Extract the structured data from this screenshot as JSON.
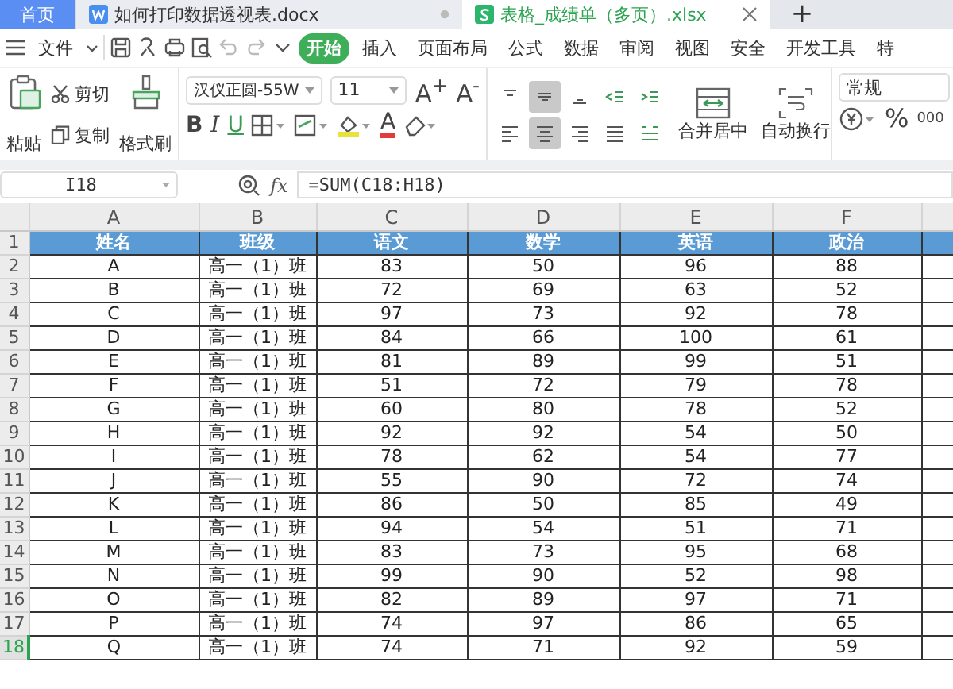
{
  "tabs": [
    {
      "label": "首页",
      "kind": "home",
      "selected": false
    },
    {
      "label": "如何打印数据透视表.docx",
      "kind": "doc",
      "selected": false
    },
    {
      "label": "表格_成绩单（多页）.xlsx",
      "kind": "sheet",
      "selected": true
    }
  ],
  "new_tab": "+",
  "menu": {
    "file": "文件",
    "items": [
      {
        "label": "开始",
        "selected": true
      },
      {
        "label": "插入",
        "selected": false
      },
      {
        "label": "页面布局",
        "selected": false
      },
      {
        "label": "公式",
        "selected": false
      },
      {
        "label": "数据",
        "selected": false
      },
      {
        "label": "审阅",
        "selected": false
      },
      {
        "label": "视图",
        "selected": false
      },
      {
        "label": "安全",
        "selected": false
      },
      {
        "label": "开发工具",
        "selected": false
      },
      {
        "label": "特",
        "selected": false
      }
    ]
  },
  "toolbar": {
    "paste": "粘贴",
    "cut": "剪切",
    "copy": "复制",
    "format_painter": "格式刷",
    "font": "汉仪正圆-55W",
    "size": "11",
    "grow": "A$^{+}$",
    "shrink": "A$^{-}$",
    "bold": "B",
    "italic": "I",
    "underline": "U",
    "font_color": "A",
    "merge": "合并居中",
    "wrap": "自动换行",
    "number_format": "常规",
    "percent": "%",
    "thousands": "000",
    "align": [
      {
        "kind": "top",
        "selected": false
      },
      {
        "kind": "middle",
        "selected": true
      },
      {
        "kind": "bottom",
        "selected": false
      },
      {
        "kind": "outdent",
        "selected": false
      },
      {
        "kind": "indent",
        "selected": false
      },
      {
        "kind": "left",
        "selected": false
      },
      {
        "kind": "center",
        "selected": true
      },
      {
        "kind": "right",
        "selected": false
      },
      {
        "kind": "justify",
        "selected": false
      },
      {
        "kind": "distributed",
        "selected": false
      }
    ]
  },
  "formula_bar": {
    "cell": "I18",
    "fx": "fx",
    "formula": "=SUM(C18:H18)"
  },
  "sheet": {
    "columns": [
      "A",
      "B",
      "C",
      "D",
      "E",
      "F"
    ],
    "rows": [
      {
        "number": "1",
        "selected": false,
        "header": true,
        "cells": [
          "姓名",
          "班级",
          "语文",
          "数学",
          "英语",
          "政治"
        ]
      },
      {
        "number": "2",
        "selected": false,
        "cells": [
          "A",
          "高一（1）班",
          "83",
          "50",
          "96",
          "88"
        ]
      },
      {
        "number": "3",
        "selected": false,
        "cells": [
          "B",
          "高一（1）班",
          "72",
          "69",
          "63",
          "52"
        ]
      },
      {
        "number": "4",
        "selected": false,
        "cells": [
          "C",
          "高一（1）班",
          "97",
          "73",
          "92",
          "78"
        ]
      },
      {
        "number": "5",
        "selected": false,
        "cells": [
          "D",
          "高一（1）班",
          "84",
          "66",
          "100",
          "61"
        ]
      },
      {
        "number": "6",
        "selected": false,
        "cells": [
          "E",
          "高一（1）班",
          "81",
          "89",
          "99",
          "51"
        ]
      },
      {
        "number": "7",
        "selected": false,
        "cells": [
          "F",
          "高一（1）班",
          "51",
          "72",
          "79",
          "78"
        ]
      },
      {
        "number": "8",
        "selected": false,
        "cells": [
          "G",
          "高一（1）班",
          "60",
          "80",
          "78",
          "52"
        ]
      },
      {
        "number": "9",
        "selected": false,
        "cells": [
          "H",
          "高一（1）班",
          "92",
          "92",
          "54",
          "50"
        ]
      },
      {
        "number": "10",
        "selected": false,
        "cells": [
          "I",
          "高一（1）班",
          "78",
          "62",
          "54",
          "77"
        ]
      },
      {
        "number": "11",
        "selected": false,
        "cells": [
          "J",
          "高一（1）班",
          "55",
          "90",
          "72",
          "74"
        ]
      },
      {
        "number": "12",
        "selected": false,
        "cells": [
          "K",
          "高一（1）班",
          "86",
          "50",
          "85",
          "49"
        ]
      },
      {
        "number": "13",
        "selected": false,
        "cells": [
          "L",
          "高一（1）班",
          "94",
          "54",
          "51",
          "71"
        ]
      },
      {
        "number": "14",
        "selected": false,
        "cells": [
          "M",
          "高一（1）班",
          "83",
          "73",
          "95",
          "68"
        ]
      },
      {
        "number": "15",
        "selected": false,
        "cells": [
          "N",
          "高一（1）班",
          "99",
          "90",
          "52",
          "98"
        ]
      },
      {
        "number": "16",
        "selected": false,
        "cells": [
          "O",
          "高一（1）班",
          "82",
          "89",
          "97",
          "71"
        ]
      },
      {
        "number": "17",
        "selected": false,
        "cells": [
          "P",
          "高一（1）班",
          "74",
          "97",
          "86",
          "65"
        ]
      },
      {
        "number": "18",
        "selected": true,
        "cells": [
          "Q",
          "高一（1）班",
          "74",
          "71",
          "92",
          "59"
        ]
      }
    ]
  }
}
